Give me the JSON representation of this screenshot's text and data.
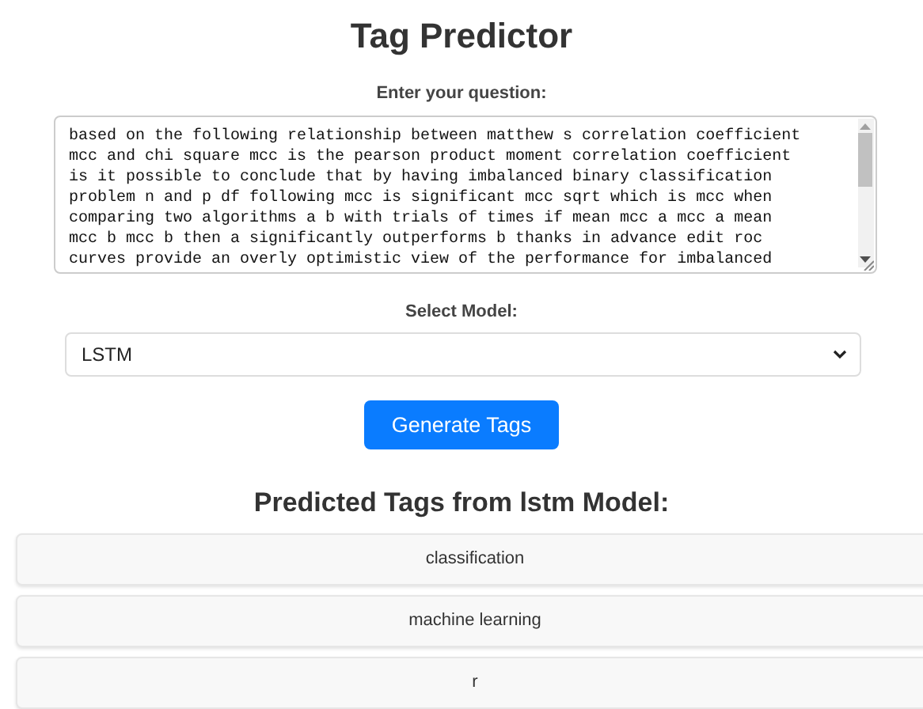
{
  "title": "Tag Predictor",
  "question": {
    "label": "Enter your question:",
    "lines": [
      "based on the following relationship between matthew s correlation coefficient",
      "mcc and chi square mcc is the pearson product moment correlation coefficient",
      "is it possible to conclude that by having imbalanced binary classification",
      "problem n and p df following mcc is significant mcc sqrt which is mcc when",
      "comparing two algorithms a b with trials of times if mean mcc a mcc a mean",
      "mcc b mcc b then a significantly outperforms b thanks in advance edit roc",
      "curves provide an overly optimistic view of the performance for imbalanced"
    ]
  },
  "model": {
    "label": "Select Model:",
    "value": "LSTM"
  },
  "generate_button": "Generate Tags",
  "results_heading": "Predicted Tags from lstm Model:",
  "tags": [
    "classification",
    "machine learning",
    "r"
  ]
}
